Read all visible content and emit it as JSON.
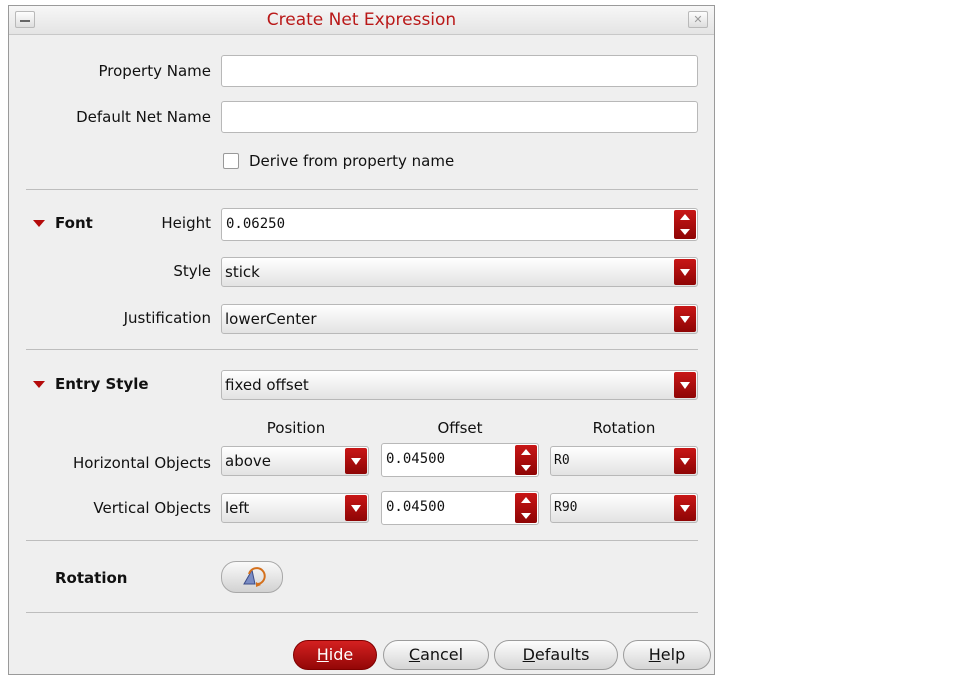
{
  "window": {
    "title": "Create Net Expression"
  },
  "form": {
    "property_name_label": "Property Name",
    "property_name_value": "",
    "default_net_name_label": "Default Net Name",
    "default_net_name_value": "",
    "derive_label": "Derive from property name",
    "derive_checked": false
  },
  "font": {
    "section_label": "Font",
    "height_label": "Height",
    "height_value": "0.06250",
    "style_label": "Style",
    "style_value": "stick",
    "justification_label": "Justification",
    "justification_value": "lowerCenter"
  },
  "entry_style": {
    "section_label": "Entry Style",
    "value": "fixed offset",
    "col_position": "Position",
    "col_offset": "Offset",
    "col_rotation": "Rotation",
    "horizontal": {
      "label": "Horizontal Objects",
      "position": "above",
      "offset": "0.04500",
      "rotation": "R0"
    },
    "vertical": {
      "label": "Vertical Objects",
      "position": "left",
      "offset": "0.04500",
      "rotation": "R90"
    }
  },
  "rotation": {
    "label": "Rotation",
    "icon": "rotate-icon"
  },
  "buttons": {
    "hide_u": "H",
    "hide_rest": "ide",
    "cancel_u": "C",
    "cancel_rest": "ancel",
    "defaults_u": "D",
    "defaults_rest": "efaults",
    "help_u": "H",
    "help_rest": "elp"
  },
  "colors": {
    "accent": "#b40b0b",
    "title": "#b91818"
  }
}
